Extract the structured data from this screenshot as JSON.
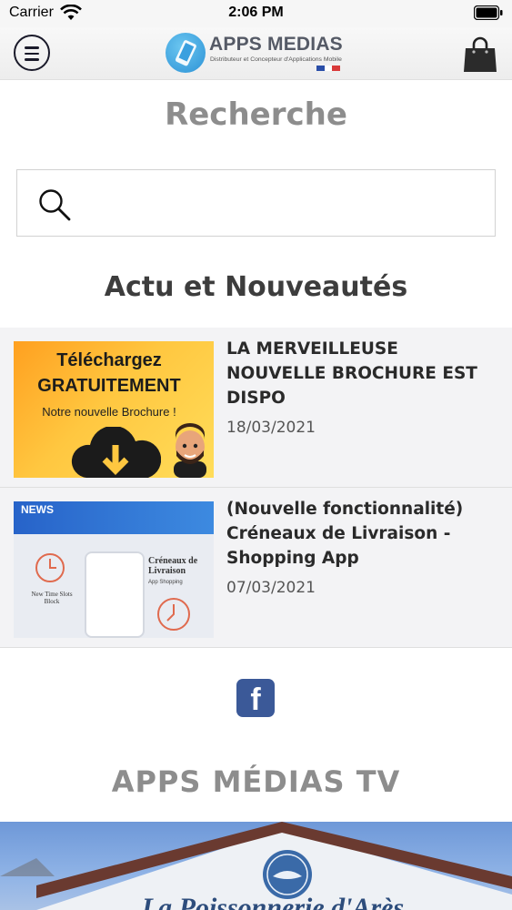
{
  "status_bar": {
    "carrier": "Carrier",
    "time": "2:06 PM"
  },
  "nav": {
    "logo_title": "APPS MEDIAS",
    "logo_subtitle": "Distributeur et Concepteur d'Applications Mobile",
    "menu_icon": "hamburger-icon",
    "cart_icon": "shopping-bag-icon"
  },
  "search": {
    "title": "Recherche",
    "value": "",
    "placeholder": ""
  },
  "news": {
    "section_title": "Actu et Nouveautés",
    "items": [
      {
        "title": "LA MERVEILLEUSE NOUVELLE BROCHURE EST DISPO",
        "date": "18/03/2021",
        "thumb_line1": "Téléchargez",
        "thumb_line2": "GRATUITEMENT",
        "thumb_line3": "Notre nouvelle Brochure !"
      },
      {
        "title": "(Nouvelle fonctionnalité) Créneaux de Livraison - Shopping App",
        "date": "07/03/2021",
        "thumb_banner": "NEWS",
        "thumb_label_left": "New Time Slots Block",
        "thumb_label_right": "Créneaux de Livraison",
        "thumb_label_app": "App Shopping"
      }
    ]
  },
  "social": {
    "facebook_letter": "f"
  },
  "tv": {
    "title": "APPS MÉDIAS TV",
    "video_sign": "La Poissonnerie d'Arès"
  },
  "colors": {
    "brand_blue": "#2c92d6",
    "facebook_blue": "#3b5998",
    "title_gray": "#8d8d8d"
  }
}
